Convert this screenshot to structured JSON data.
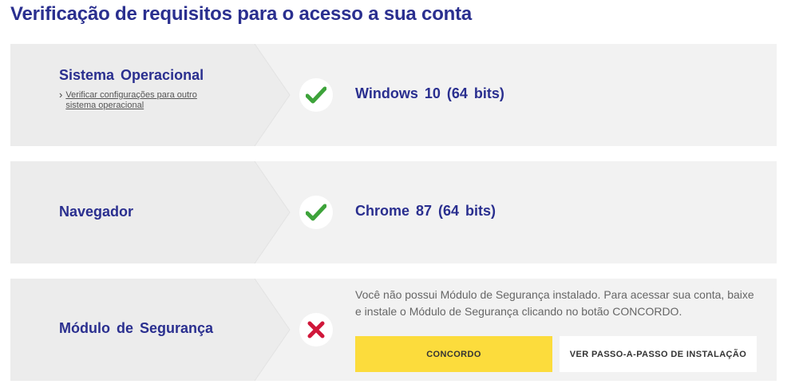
{
  "page": {
    "title": "Verificação de requisitos para o acesso a sua conta"
  },
  "colors": {
    "title_blue": "#2a2f8f",
    "card_bg": "#f2f2f2",
    "chevron_bg": "#ececec",
    "ok_green": "#3da33a",
    "error_red": "#d0173a",
    "agree_yellow": "#fcdc3c"
  },
  "checks": [
    {
      "label": "Sistema Operacional",
      "sub_link": "Verificar configurações para outro sistema operacional",
      "status": "ok",
      "status_icon": "check-icon",
      "value": "Windows 10 (64 bits)"
    },
    {
      "label": "Navegador",
      "status": "ok",
      "status_icon": "check-icon",
      "value": "Chrome 87 (64 bits)"
    },
    {
      "label": "Módulo de Segurança",
      "status": "error",
      "status_icon": "x-icon",
      "message": "Você não possui Módulo de Segurança instalado. Para acessar sua conta, baixe e instale o Módulo de Segurança clicando no botão CONCORDO.",
      "buttons": {
        "agree": "CONCORDO",
        "steps": "VER PASSO-A-PASSO DE INSTALAÇÃO"
      }
    }
  ]
}
